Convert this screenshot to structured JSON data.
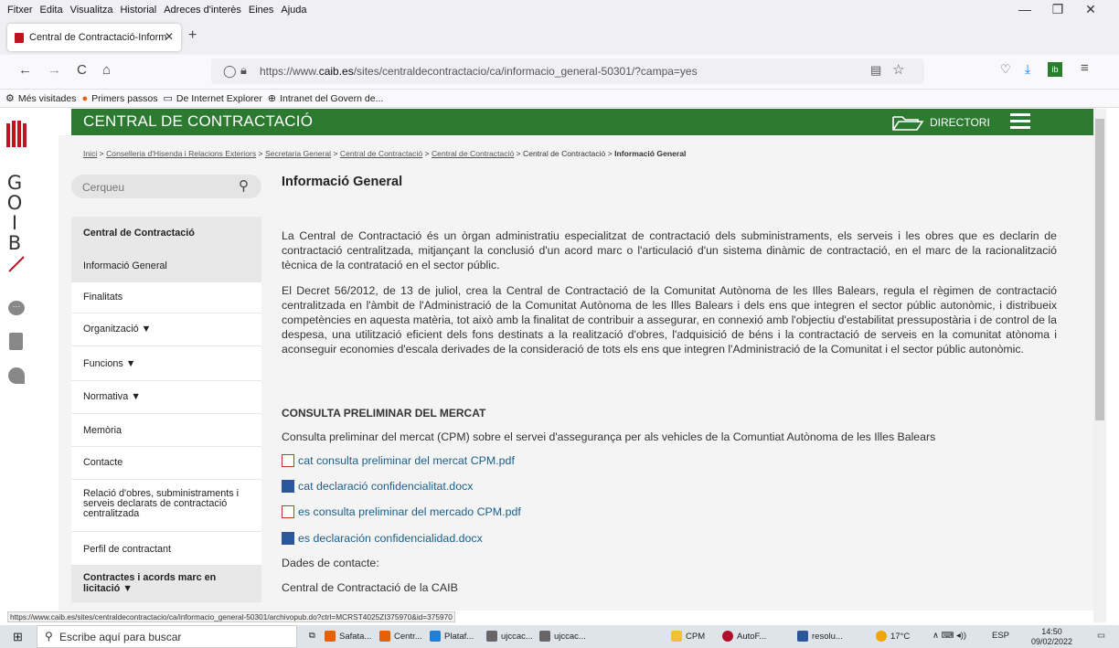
{
  "menubar": {
    "items": [
      "Fitxer",
      "Edita",
      "Visualitza",
      "Historial",
      "Adreces d'interès",
      "Eines",
      "Ajuda"
    ]
  },
  "window": {
    "minimize": "—",
    "restore": "❐",
    "close": "✕"
  },
  "tab": {
    "title": "Central de Contractació-Inform",
    "close": "✕",
    "new_tab": "+"
  },
  "nav": {
    "back": "←",
    "forward": "→",
    "reload": "C",
    "home": "⌂",
    "url_prefix": "https://www.",
    "url_domain": "caib.es",
    "url_rest": "/sites/centraldecontractacio/ca/informacio_general-50301/?campa=yes"
  },
  "bookmarks": {
    "items": [
      "Més visitades",
      "Primers passos",
      "De Internet Explorer",
      "Intranet del Govern de..."
    ]
  },
  "goib": {
    "letters": "GOIB"
  },
  "site": {
    "title": "CENTRAL DE CONTRACTACIÓ",
    "directori": "DIRECTORI"
  },
  "breadcrumb": {
    "parts": [
      "Inici",
      "Conselleria d'Hisenda i Relacions Exteriors",
      "Secretaria General",
      "Central de Contractació",
      "Central de Contractació",
      "Central de Contractació",
      "Informació General"
    ],
    "sep": " > "
  },
  "search": {
    "placeholder": "Cerqueu"
  },
  "sidebar": {
    "items": [
      {
        "label": "Central de Contractació"
      },
      {
        "label": "Informació General"
      },
      {
        "label": "Finalitats"
      },
      {
        "label": "Organització ▼"
      },
      {
        "label": "Funcions ▼"
      },
      {
        "label": "Normativa ▼"
      },
      {
        "label": "Memòria"
      },
      {
        "label": "Contacte"
      },
      {
        "label": "Relació d'obres, subministraments i serveis declarats de contractació centralitzada"
      },
      {
        "label": "Perfil de contractant"
      },
      {
        "label": "Contractes i acords marc en licitació ▼"
      }
    ]
  },
  "main": {
    "title": "Informació General",
    "p1": "La Central de Contractació és un òrgan administratiu especialitzat de contractació dels subministraments, els serveis i les obres que es declarin de contractació centralitzada, mitjançant la conclusió d'un acord marc o l'articulació d'un sistema dinàmic de contractació, en el marc de la racionalització tècnica de la contratació en el sector públic.",
    "p2": "El Decret 56/2012, de 13 de juliol, crea la Central de Contractació de la Comunitat Autònoma de les Illes Balears, regula el règimen de contractació centralitzada en l'àmbit de l'Administració de la Comunitat Autònoma de les Illes Balears i dels ens que integren el sector públic autonòmic, i distribueix competències en aquesta matèria, tot això amb la finalitat de contribuir a assegurar, en connexió amb l'objectiu d'estabilitat pressupostària i de control de la despesa, una utilització eficient dels fons destinats a la realització d'obres, l'adquisició de béns i la contractació de serveis en la comunitat atònoma i aconseguir economies d'escala derivades de la consideració de tots els ens que integren l'Administració de la Comunitat i el sector públic autonòmic.",
    "section": "CONSULTA PRELIMINAR DEL MERCAT",
    "section_desc": "Consulta preliminar del mercat (CPM) sobre el servei d'assegurança per als vehicles de la Comuntiat Autònoma de les Illes Balears",
    "links": [
      {
        "label": "cat consulta preliminar del mercat CPM.pdf",
        "kind": "pdf"
      },
      {
        "label": "cat declaració confidencialitat.docx",
        "kind": "word"
      },
      {
        "label": "es consulta preliminar del mercado CPM.pdf",
        "kind": "pdf"
      },
      {
        "label": "es declaración confidencialidad.docx",
        "kind": "word"
      }
    ],
    "contact_label": "Dades de contacte:",
    "contact_name": "Central de Contractació de la CAIB"
  },
  "status": {
    "url": "https://www.caib.es/sites/centraldecontractacio/ca/informacio_general-50301/archivopub.do?ctrl=MCRST4025ZI375970&id=375970"
  },
  "taskbar": {
    "search_placeholder": "Escribe aquí para buscar",
    "apps": [
      "Safata...",
      "Centr...",
      "Plataf...",
      "ujccac...",
      "ujccac...",
      "CPM",
      "AutoF...",
      "resolu..."
    ],
    "weather": "17°C",
    "lang": "ESP",
    "time": "14:50",
    "date": "09/02/2022"
  },
  "colors": {
    "green": "#2c7a2f",
    "link": "#1a5f8a"
  }
}
